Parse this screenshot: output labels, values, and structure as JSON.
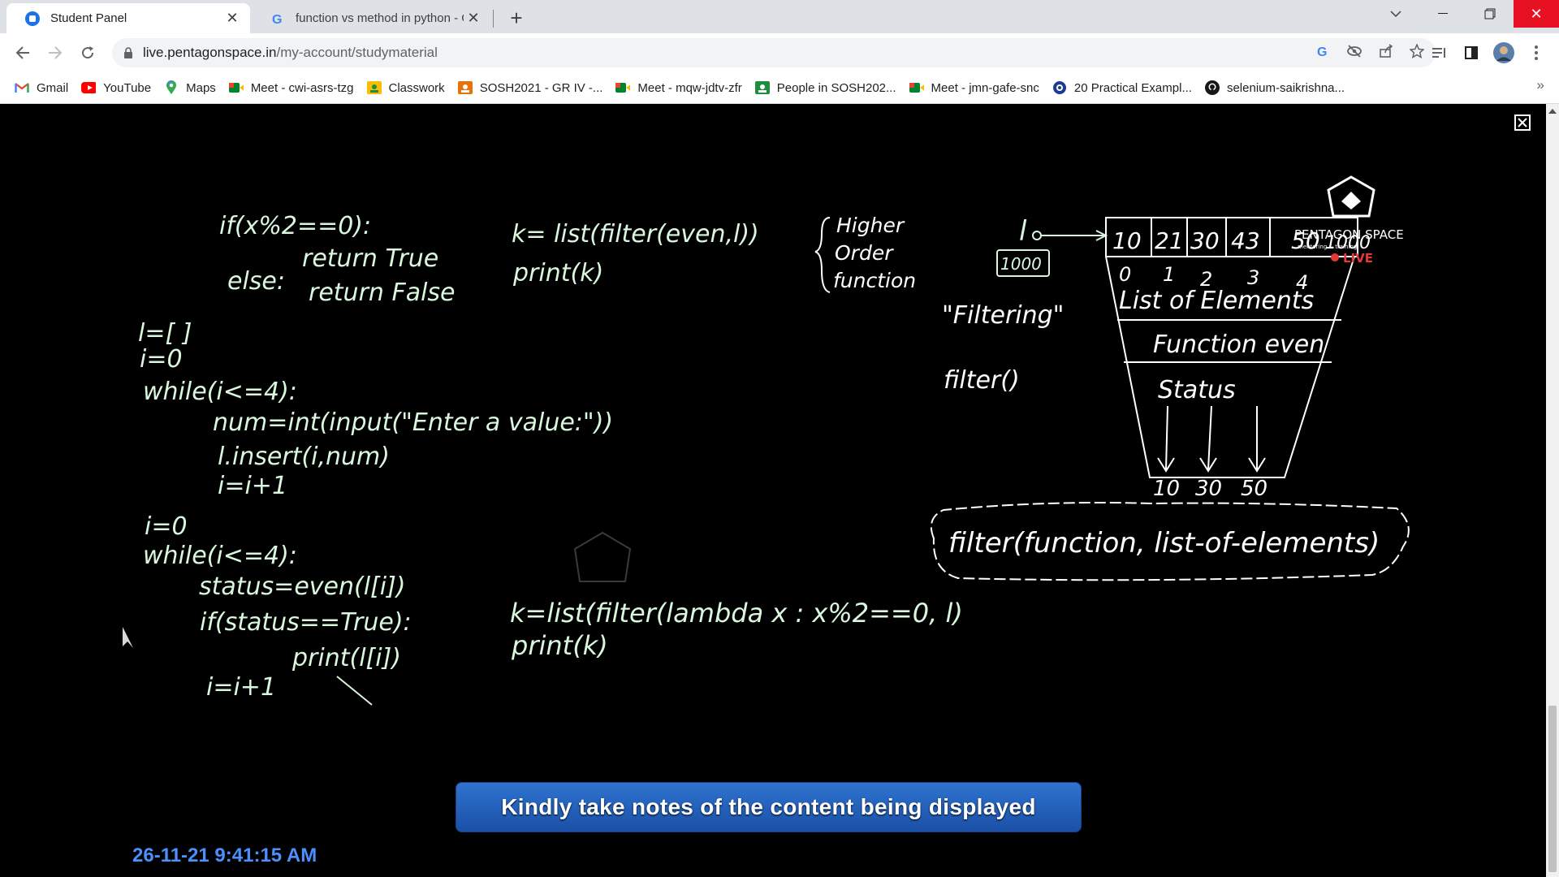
{
  "browser": {
    "tabs": [
      {
        "label": "Student Panel",
        "active": true
      },
      {
        "label": "function vs method in python - G",
        "active": false
      }
    ],
    "address": {
      "domain": "live.pentagonspace.in",
      "path": "/my-account/studymaterial"
    },
    "bookmarks": [
      {
        "label": "Gmail",
        "icon": "gmail-icon"
      },
      {
        "label": "YouTube",
        "icon": "youtube-icon"
      },
      {
        "label": "Maps",
        "icon": "maps-icon"
      },
      {
        "label": "Meet - cwi-asrs-tzg",
        "icon": "meet-icon"
      },
      {
        "label": "Classwork",
        "icon": "classroom-icon"
      },
      {
        "label": "SOSH2021 - GR IV -...",
        "icon": "classroom-icon"
      },
      {
        "label": "Meet - mqw-jdtv-zfr",
        "icon": "meet-icon"
      },
      {
        "label": "People in SOSH202...",
        "icon": "classroom-icon"
      },
      {
        "label": "Meet - jmn-gafe-snc",
        "icon": "meet-icon"
      },
      {
        "label": "20 Practical Exampl...",
        "icon": "site-icon"
      },
      {
        "label": "selenium-saikrishna...",
        "icon": "github-icon"
      }
    ],
    "bookmarks_more": "»"
  },
  "board": {
    "code_top": [
      "if(x%2==0):",
      "return True",
      "else:",
      "return False"
    ],
    "code_mid": [
      "l=[ ]",
      "i=0",
      "while(i<=4):",
      "num=int(input(\"Enter a value:\"))",
      "l.insert(i,num)",
      "i=i+1"
    ],
    "code_bottom": [
      "i=0",
      "while(i<=4):",
      "status=even(l[i])",
      "if(status==True):",
      "print(l[i])",
      "i=i+1"
    ],
    "filter_call": [
      "k= list(filter(even,l))",
      "print(k)"
    ],
    "brace_note": [
      "Higher",
      "Order",
      "function"
    ],
    "lambda_call": [
      "k=list(filter(lambda x : x%2==0, l)",
      "print(k)"
    ],
    "list_label": "l",
    "list_address": "1000",
    "filtering": "\"Filtering\"",
    "filter_fn": "filter()",
    "array_values": [
      "10",
      "21",
      "30",
      "43",
      "50"
    ],
    "array_indexes": [
      "0",
      "1",
      "2",
      "3",
      "4"
    ],
    "array_address": "1000",
    "funnel_rows": [
      "List of Elements",
      "Function even",
      "Status"
    ],
    "outputs": [
      "10",
      "30",
      "50"
    ],
    "syntax": "filter(function, list-of-elements)",
    "brand": "PENTAGON SPACE",
    "brand_sub": "mentoring & training",
    "live": "LIVE"
  },
  "overlay": {
    "banner": "Kindly take notes of the content being displayed",
    "timestamp": "26-11-21 9:41:15 AM"
  }
}
